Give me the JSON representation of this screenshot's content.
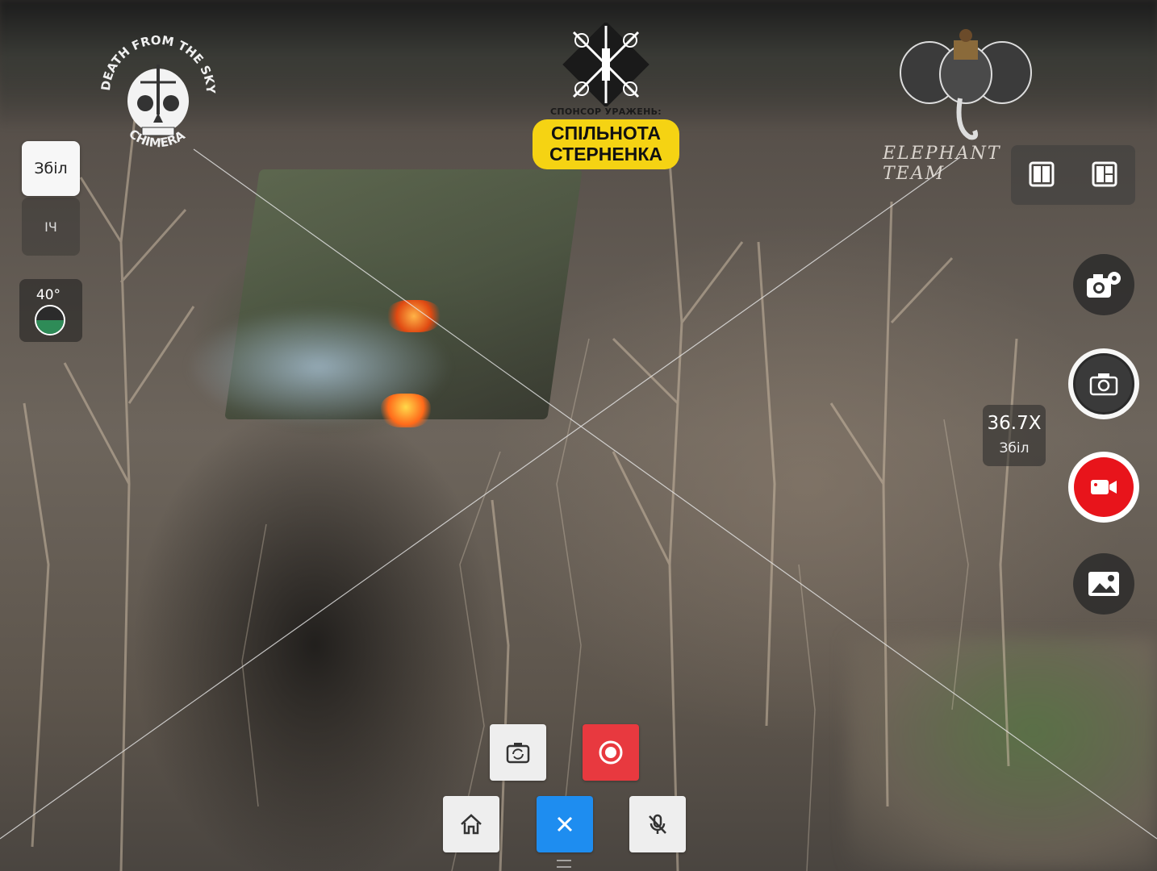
{
  "logos": {
    "left_text_top": "DEATH FROM THE SKY",
    "left_text_bottom": "CHIMERA",
    "sponsor_line": "СПОНСОР УРАЖЕНЬ:",
    "sponsor_title_1": "СПІЛЬНОТА",
    "sponsor_title_2": "СТЕРНЕНКА",
    "right_text": "ELEPHANT TEAM"
  },
  "left_controls": {
    "zoom_chip_label": "Збіл",
    "ir_chip_label": "ІЧ",
    "gimbal_pitch": "40°"
  },
  "right_controls": {
    "zoom_value": "36.7X",
    "zoom_label": "Збіл"
  },
  "colors": {
    "record": "#e8141b",
    "stop_button": "#1e8df0",
    "record_small": "#e8393f",
    "sponsor_yellow": "#f5d313"
  },
  "icons": {
    "layout_split": "split-view-icon",
    "layout_pip": "pip-layout-icon",
    "camera_settings": "camera-settings-icon",
    "shutter": "camera-icon",
    "record": "video-camera-icon",
    "gallery": "gallery-icon",
    "switch_camera": "switch-camera-icon",
    "record_small": "record-icon",
    "home": "home-icon",
    "close": "close-icon",
    "mic_off": "mic-off-icon"
  }
}
